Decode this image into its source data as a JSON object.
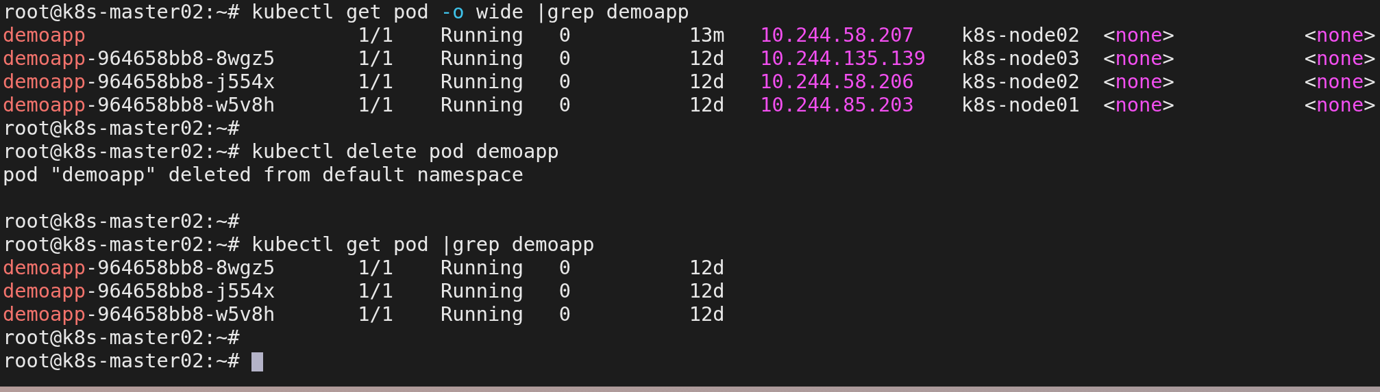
{
  "terminal": {
    "lines": [
      {
        "kind": "prompt",
        "prompt": "root@k8s-master02:~#",
        "command": [
          {
            "kind": "plain",
            "text": "kubectl get pod "
          },
          {
            "kind": "flag",
            "text": "-o"
          },
          {
            "kind": "plain",
            "text": " wide |grep demoapp"
          }
        ],
        "cursor": false
      },
      {
        "kind": "pod_row",
        "name_match": "demoapp",
        "ready": "1/1",
        "status": "Running",
        "restarts": "0",
        "age": "13m",
        "ip": "10.244.58.207",
        "node": "k8s-node02",
        "nominated_node": {
          "open": "<",
          "value": "none",
          "close": ">"
        },
        "readiness_gates": {
          "open": "<",
          "value": "none",
          "close": ">"
        }
      },
      {
        "kind": "pod_row",
        "name_match": "demoapp",
        "name_rest": "-964658bb8-8wgz5",
        "ready": "1/1",
        "status": "Running",
        "restarts": "0",
        "age": "12d",
        "ip": "10.244.135.139",
        "node": "k8s-node03",
        "nominated_node": {
          "open": "<",
          "value": "none",
          "close": ">"
        },
        "readiness_gates": {
          "open": "<",
          "value": "none",
          "close": ">"
        }
      },
      {
        "kind": "pod_row",
        "name_match": "demoapp",
        "name_rest": "-964658bb8-j554x",
        "ready": "1/1",
        "status": "Running",
        "restarts": "0",
        "age": "12d",
        "ip": "10.244.58.206",
        "node": "k8s-node02",
        "nominated_node": {
          "open": "<",
          "value": "none",
          "close": ">"
        },
        "readiness_gates": {
          "open": "<",
          "value": "none",
          "close": ">"
        }
      },
      {
        "kind": "pod_row",
        "name_match": "demoapp",
        "name_rest": "-964658bb8-w5v8h",
        "ready": "1/1",
        "status": "Running",
        "restarts": "0",
        "age": "12d",
        "ip": "10.244.85.203",
        "node": "k8s-node01",
        "nominated_node": {
          "open": "<",
          "value": "none",
          "close": ">"
        },
        "readiness_gates": {
          "open": "<",
          "value": "none",
          "close": ">"
        }
      },
      {
        "kind": "prompt",
        "prompt": "root@k8s-master02:~#",
        "cursor": false
      },
      {
        "kind": "prompt",
        "prompt": "root@k8s-master02:~#",
        "command": [
          {
            "kind": "plain",
            "text": "kubectl delete pod demoapp"
          }
        ],
        "cursor": false
      },
      {
        "kind": "output",
        "text": "pod \"demoapp\" deleted from default namespace"
      },
      {
        "kind": "blank"
      },
      {
        "kind": "prompt",
        "prompt": "root@k8s-master02:~#",
        "cursor": false
      },
      {
        "kind": "prompt",
        "prompt": "root@k8s-master02:~#",
        "command": [
          {
            "kind": "plain",
            "text": "kubectl get pod |grep demoapp"
          }
        ],
        "cursor": false
      },
      {
        "kind": "pod_row",
        "name_match": "demoapp",
        "name_rest": "-964658bb8-8wgz5",
        "ready": "1/1",
        "status": "Running",
        "restarts": "0",
        "age": "12d"
      },
      {
        "kind": "pod_row",
        "name_match": "demoapp",
        "name_rest": "-964658bb8-j554x",
        "ready": "1/1",
        "status": "Running",
        "restarts": "0",
        "age": "12d"
      },
      {
        "kind": "pod_row",
        "name_match": "demoapp",
        "name_rest": "-964658bb8-w5v8h",
        "ready": "1/1",
        "status": "Running",
        "restarts": "0",
        "age": "12d"
      },
      {
        "kind": "prompt",
        "prompt": "root@k8s-master02:~#",
        "cursor": false
      },
      {
        "kind": "prompt",
        "prompt": "root@k8s-master02:~#",
        "cursor": true
      }
    ]
  }
}
